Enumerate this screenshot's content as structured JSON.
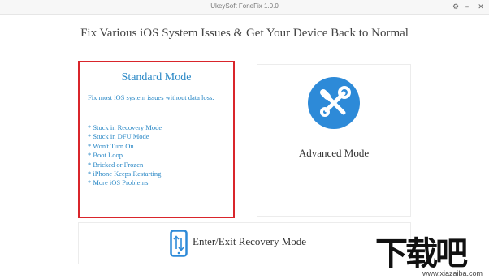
{
  "window": {
    "title": "UkeySoft FoneFix 1.0.0",
    "settings_icon": "⚙",
    "minimize_icon": "–",
    "close_icon": "✕"
  },
  "headline": "Fix Various iOS System Issues & Get Your Device Back to Normal",
  "standard_mode": {
    "title": "Standard Mode",
    "description": "Fix most iOS system issues without data loss.",
    "items": [
      "* Stuck in Recovery Mode",
      "* Stuck in DFU Mode",
      "* Won't Turn On",
      "* Boot Loop",
      "* Bricked or Frozen",
      "* iPhone Keeps Restarting",
      "* More iOS Problems"
    ],
    "highlight_color": "#d9252b",
    "text_color": "#2a88c6"
  },
  "advanced_mode": {
    "title": "Advanced Mode",
    "icon": "wrench-screwdriver-icon",
    "icon_color": "#2d8ad8"
  },
  "recovery_mode": {
    "title": "Enter/Exit Recovery Mode",
    "icon": "phone-arrows-icon"
  },
  "watermark": {
    "text": "下载吧",
    "url": "www.xiazaiba.com"
  }
}
